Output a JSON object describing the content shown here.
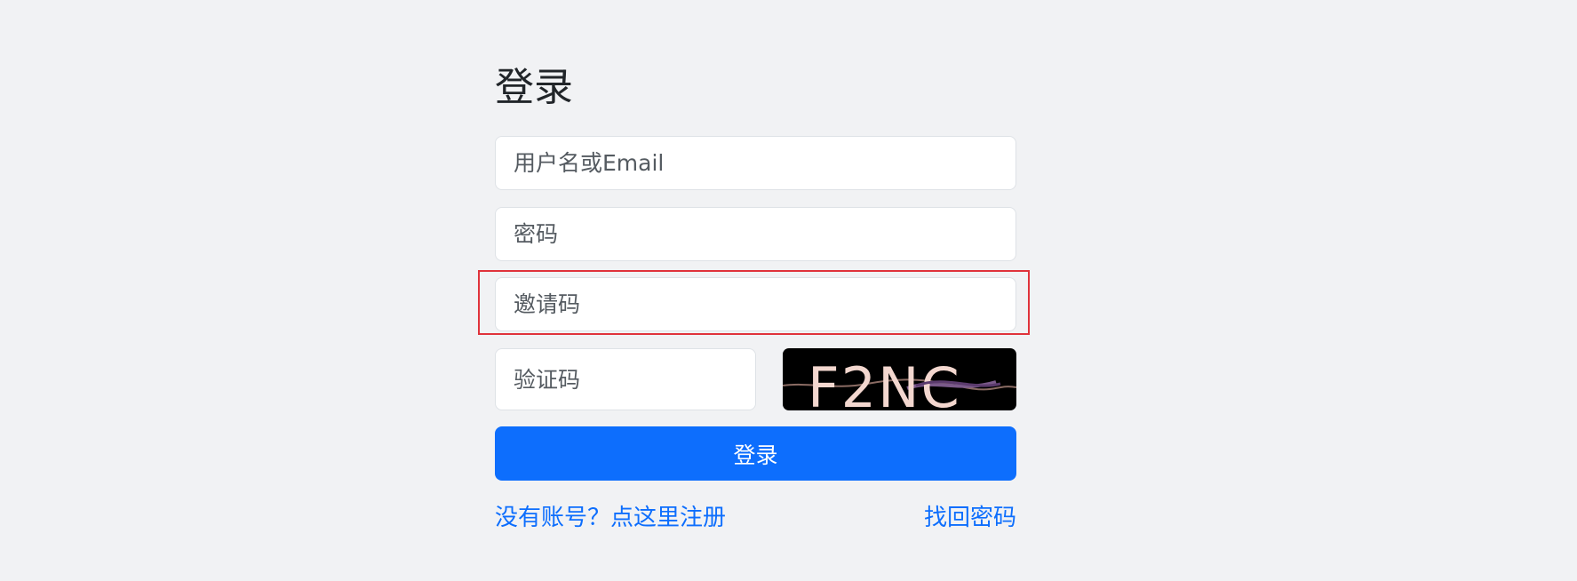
{
  "page": {
    "title": "登录"
  },
  "form": {
    "username_placeholder": "用户名或Email",
    "password_placeholder": "密码",
    "invite_placeholder": "邀请码",
    "captcha_placeholder": "验证码",
    "captcha_text": "F2NC",
    "submit_label": "登录"
  },
  "links": {
    "register": "没有账号？点这里注册",
    "forgot_password": "找回密码"
  },
  "colors": {
    "background": "#f1f2f4",
    "primary": "#0d6efd",
    "highlight": "#e0333b",
    "captcha_background": "#000000",
    "captcha_text": "#f3d7cf"
  }
}
